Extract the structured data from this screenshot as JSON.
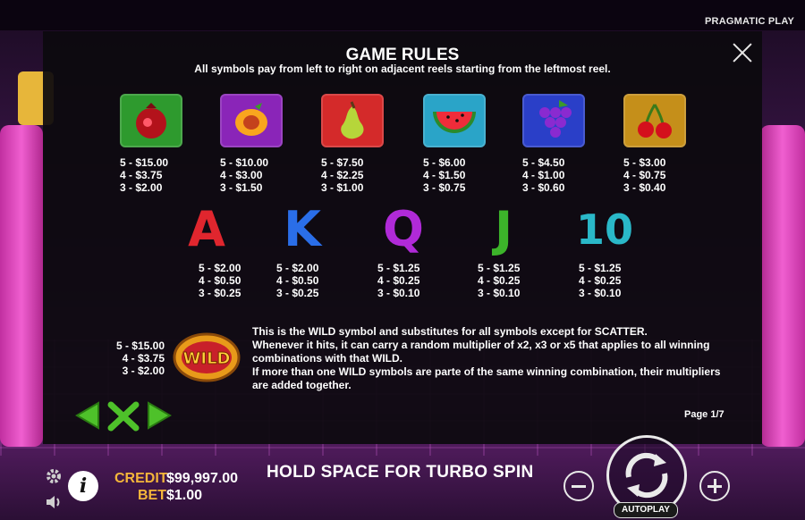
{
  "provider": "PRAGMATIC PLAY",
  "rules": {
    "title": "GAME RULES",
    "subtitle": "All symbols pay from left to right on adjacent reels starting from the leftmost reel.",
    "page": "Page 1/7"
  },
  "fruits": [
    {
      "name": "pomegranate",
      "color": "#2e9a2e",
      "pays": [
        "5 - $15.00",
        "4 - $3.75",
        "3 - $2.00"
      ]
    },
    {
      "name": "peach",
      "color": "#8a25b8",
      "pays": [
        "5 - $10.00",
        "4 - $3.00",
        "3 - $1.50"
      ]
    },
    {
      "name": "pear",
      "color": "#d42a2a",
      "pays": [
        "5 - $7.50",
        "4 - $2.25",
        "3 - $1.00"
      ]
    },
    {
      "name": "watermelon",
      "color": "#2aa4c8",
      "pays": [
        "5 - $6.00",
        "4 - $1.50",
        "3 - $0.75"
      ]
    },
    {
      "name": "grapes",
      "color": "#2a3fc8",
      "pays": [
        "5 - $4.50",
        "4 - $1.00",
        "3 - $0.60"
      ]
    },
    {
      "name": "cherries",
      "color": "#c58f1a",
      "pays": [
        "5 - $3.00",
        "4 - $0.75",
        "3 - $0.40"
      ]
    }
  ],
  "letters": [
    {
      "glyph": "A",
      "color": "#e0262e",
      "pays": [
        "5 - $2.00",
        "4 - $0.50",
        "3 - $0.25"
      ]
    },
    {
      "glyph": "K",
      "color": "#2a6ee8",
      "pays": [
        "5 - $2.00",
        "4 - $0.50",
        "3 - $0.25"
      ]
    },
    {
      "glyph": "Q",
      "color": "#b02ad8",
      "pays": [
        "5 - $1.25",
        "4 - $0.25",
        "3 - $0.10"
      ]
    },
    {
      "glyph": "J",
      "color": "#3cb42a",
      "pays": [
        "5 - $1.25",
        "4 - $0.25",
        "3 - $0.10"
      ]
    },
    {
      "glyph": "10",
      "color": "#2ab8c8",
      "pays": [
        "5 - $1.25",
        "4 - $0.25",
        "3 - $0.10"
      ]
    }
  ],
  "wild": {
    "badge": "WILD",
    "pays": [
      "5 - $15.00",
      "4 - $3.75",
      "3 - $2.00"
    ],
    "lines": [
      "This is the WILD symbol and substitutes for all symbols except for SCATTER.",
      "Whenever it hits, it can carry a random multiplier of x2, x3 or x5 that applies to all winning combinations with that WILD.",
      "If more than one WILD symbols are parte of the same winning combination, their multipliers are added together."
    ]
  },
  "footer": {
    "credit_label": "CREDIT",
    "credit_value": "$99,997.00",
    "bet_label": "BET",
    "bet_value": "$1.00",
    "turbo": "HOLD SPACE FOR TURBO SPIN",
    "autoplay": "AUTOPLAY"
  },
  "colors": {
    "accent_gold": "#f4b63a",
    "nav_green": "#4ec12a"
  }
}
